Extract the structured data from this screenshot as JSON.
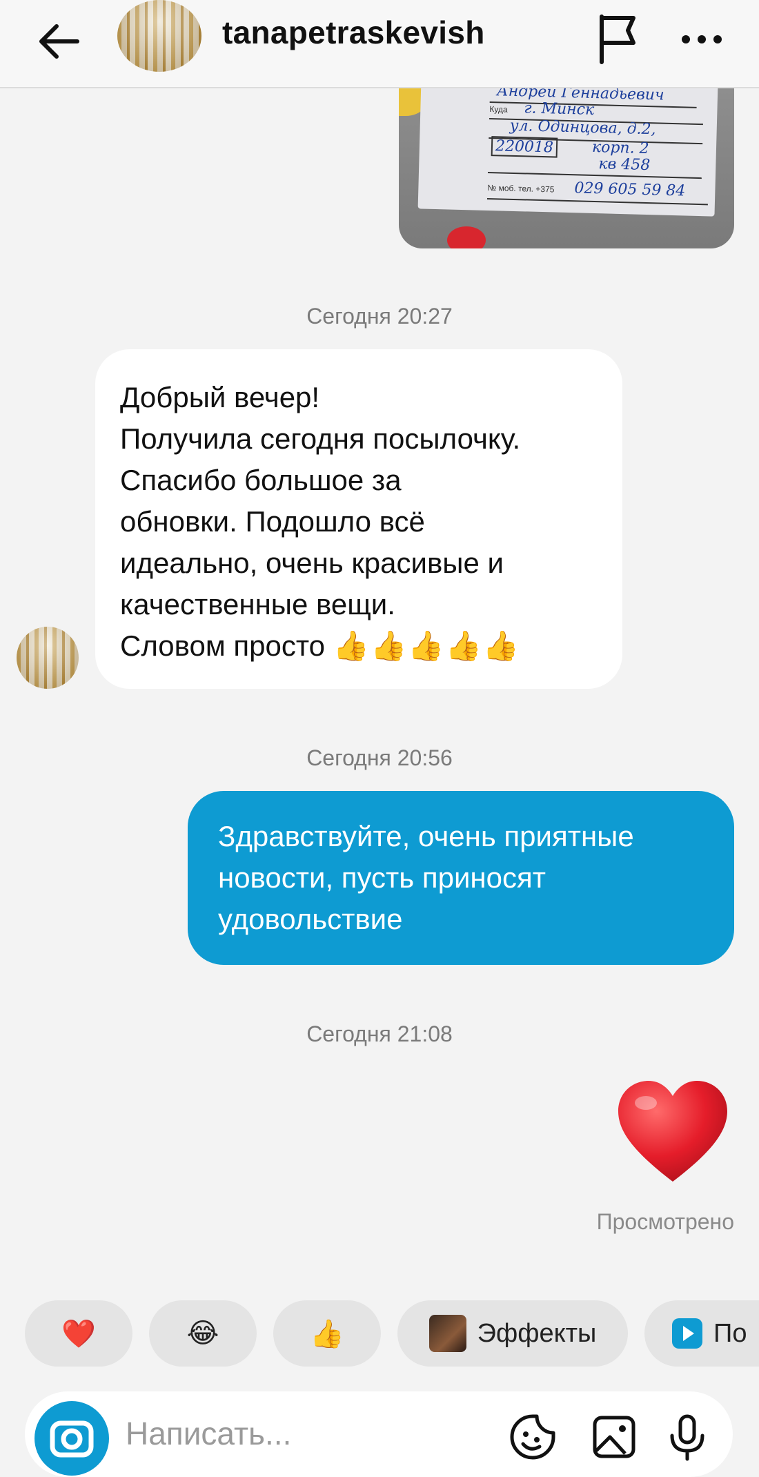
{
  "header": {
    "username": "tanapetraskevish",
    "back_icon": "arrow-left-icon",
    "flag_icon": "flag-icon",
    "more_icon": "more-dots-icon"
  },
  "package_photo": {
    "handwriting": {
      "name": "Андрей Геннадьевич",
      "to_label": "Куда",
      "city": "г. Минск",
      "street": "ул. Одинцова, д.2,",
      "postcode": "220018",
      "korp": "корп. 2",
      "apt": "кв 458",
      "phone_label": "№ моб. тел. +375",
      "phone": "029 605 59 84"
    }
  },
  "messages": {
    "ts1": "Сегодня 20:27",
    "incoming": {
      "lines": [
        "Добрый вечер!",
        "Получила сегодня посылочку.",
        "Спасибо большое за",
        "обновки. Подошло всё",
        "идеально, очень красивые и",
        "качественные вещи.",
        "Словом просто"
      ],
      "emoji": "👍👍👍👍👍"
    },
    "ts2": "Сегодня 20:56",
    "outgoing": {
      "lines": [
        "Здравствуйте, очень приятные",
        "новости, пусть приносят",
        "удовольствие"
      ]
    },
    "ts3": "Сегодня 21:08",
    "heart_emoji": "❤️",
    "seen": "Просмотрено"
  },
  "quick_reactions": {
    "chip1": "❤️",
    "chip2": "😂",
    "chip3": "👍",
    "effects_label": "Эффекты",
    "partial_label": "По"
  },
  "composer": {
    "placeholder": "Написать...",
    "icons": [
      "camera-icon",
      "sticker-icon",
      "gallery-icon",
      "microphone-icon"
    ]
  },
  "colors": {
    "accent_blue": "#0e9bd2",
    "background": "#f3f3f3",
    "bubble_incoming": "#ffffff"
  }
}
